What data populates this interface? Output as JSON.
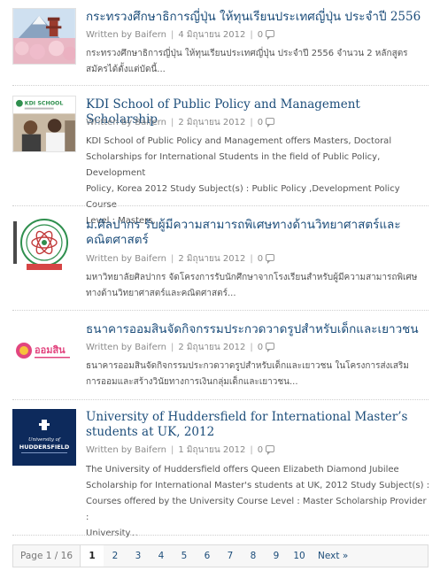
{
  "posts": [
    {
      "title": "กระทรวงศึกษาธิการญี่ปุ่น ให้ทุนเรียนประเทศญี่ปุ่น ประจำปี 2556",
      "author": "Written by Baifern",
      "date": "4 มิถุนายน 2012",
      "comments": "0",
      "excerpt_lines": [
        "กระทรวงศึกษาธิการญี่ปุ่น ให้ทุนเรียนประเทศญี่ปุ่น ประจำปี 2556 จำนวน 2 หลักสูตร",
        "สมัครได้ตั้งแต่บัดนี้..."
      ]
    },
    {
      "title": "KDI School of Public Policy and Management Scholarship",
      "author": "Written by Baifern",
      "date": "2 มิถุนายน 2012",
      "comments": "0",
      "thumb_text": "KDI SCHOOL",
      "excerpt_lines": [
        "KDI School of Public Policy and Management offers Masters, Doctoral",
        "Scholarships for International Students in the field of Public Policy, Development",
        "Policy, Korea 2012 Study Subject(s) : Public Policy ,Development Policy Course",
        "Level : Masters,..."
      ]
    },
    {
      "title": "ม.ศิลปากร รับผู้มีความสามารถพิเศษทางด้านวิทยาศาสตร์และคณิตศาสตร์",
      "author": "Written by Baifern",
      "date": "2 มิถุนายน 2012",
      "comments": "0",
      "excerpt_lines": [
        "มหาวิทยาลัยศิลปากร จัดโครงการรับนักศึกษาจากโรงเรียนสำหรับผู้มีความสามารถพิเศษ",
        "ทางด้านวิทยาศาสตร์และคณิตศาสตร์..."
      ]
    },
    {
      "title": "ธนาคารออมสินจัดกิจกรรมประกวดวาดรูปสำหรับเด็กและเยาวชน",
      "author": "Written by Baifern",
      "date": "2 มิถุนายน 2012",
      "comments": "0",
      "thumb_text": "ออมสิน",
      "excerpt_lines": [
        "ธนาคารออมสินจัดกิจกรรมประกวดวาดรูปสำหรับเด็กและเยาวชน ในโครงการส่งเสริม",
        "การออมและสร้างวินัยทางการเงินกลุ่มเด็กและเยาวชน..."
      ]
    },
    {
      "title": "University of Huddersfield for International Master’s students at UK, 2012",
      "author": "Written by Baifern",
      "date": "1 มิถุนายน 2012",
      "comments": "0",
      "thumb_text_1": "University of",
      "thumb_text_2": "HUDDERSFIELD",
      "excerpt_lines": [
        "The University of Huddersfield offers Queen Elizabeth Diamond Jubilee",
        "Scholarship for International Master's students at UK, 2012 Study Subject(s) :",
        "Courses offered by the University Course Level : Master Scholarship Provider :",
        "University..."
      ]
    }
  ],
  "pagination": {
    "page_count": "Page 1 / 16",
    "pages": [
      "1",
      "2",
      "3",
      "4",
      "5",
      "6",
      "7",
      "8",
      "9",
      "10"
    ],
    "current": "1",
    "next": "Next »"
  },
  "colors": {
    "title": "#1c4d7a",
    "text": "#555555",
    "huddersfield_bg": "#0d2a5c"
  }
}
